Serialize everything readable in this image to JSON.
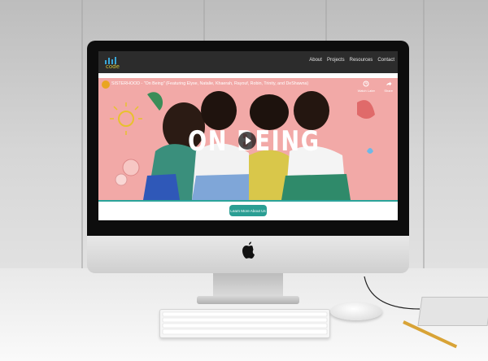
{
  "site": {
    "logo_text": "code",
    "nav": [
      "About",
      "Projects",
      "Resources",
      "Contact"
    ]
  },
  "video": {
    "title": "SISTERHOOD - \"On Being\" (Featuring Elyse, Natalie, Khaerah, Rayouf, Robin, Trinity, and DeShawna)",
    "watch_later": "Watch Later",
    "share": "Share",
    "overlay_text": "ON BEING"
  },
  "cta": {
    "label": "Learn More About Us"
  },
  "colors": {
    "nav_bg": "#2c2c2c",
    "video_bg": "#f2a9a7",
    "accent_teal": "#2a9e93"
  }
}
